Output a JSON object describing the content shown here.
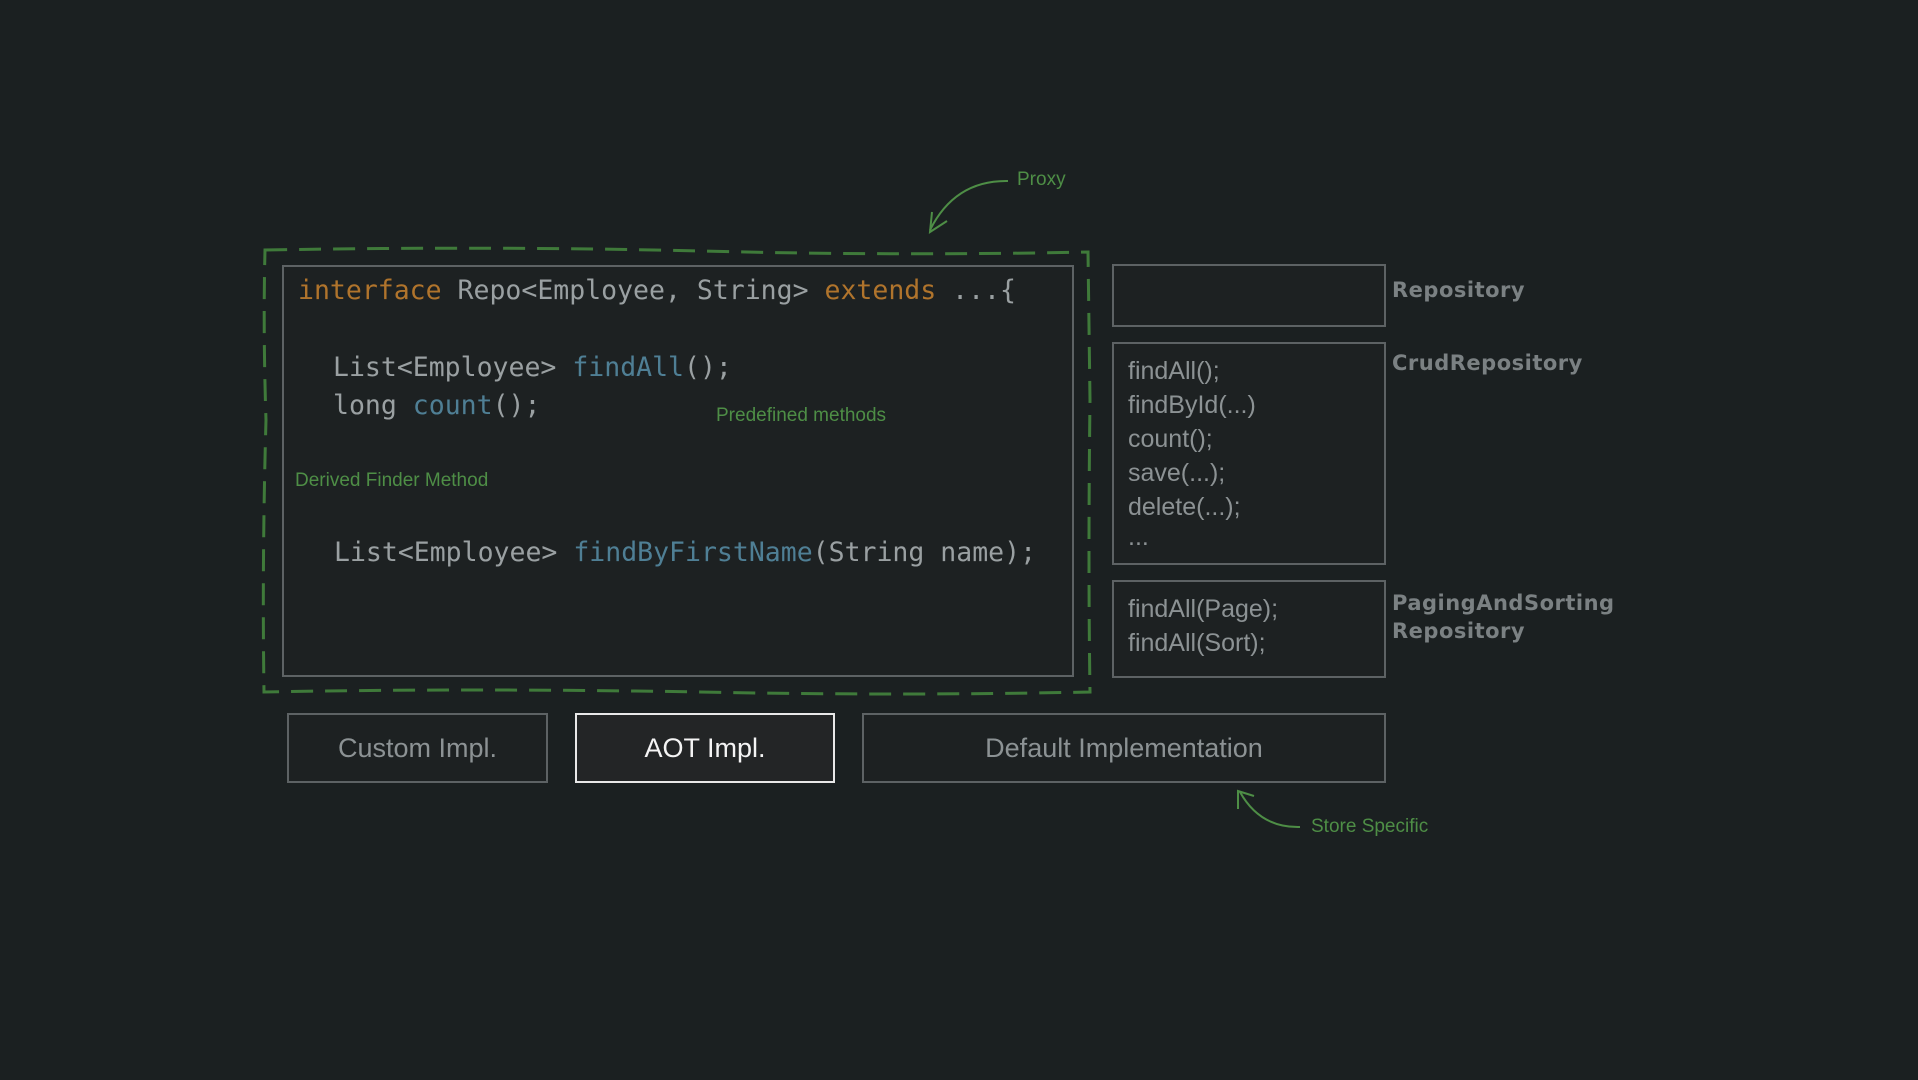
{
  "code": {
    "line1": {
      "kw1": "interface",
      "mid": " Repo<Employee, String> ",
      "kw2": "extends",
      "rest": " ...{"
    },
    "line2": {
      "pre": "List<Employee> ",
      "fn": "findAll",
      "post": "();"
    },
    "line3": {
      "pre": "long ",
      "fn": "count",
      "post": "();"
    },
    "line4": {
      "pre": "List<Employee> ",
      "fn": "findByFirstName",
      "post": "(String name);"
    }
  },
  "annotations": {
    "proxy": "Proxy",
    "predefined": "Predefined methods",
    "derived": "Derived Finder Method",
    "store": "Store Specific"
  },
  "side": {
    "repository_label": "Repository",
    "crud_label": "CrudRepository",
    "crud_items": [
      "findAll();",
      "findById(...)",
      "count();",
      "save(...);",
      "delete(...);",
      "..."
    ],
    "paging_label_line1": "PagingAndSorting",
    "paging_label_line2": "Repository",
    "paging_items": [
      "findAll(Page);",
      "findAll(Sort);"
    ]
  },
  "impl": {
    "custom": "Custom Impl.",
    "aot": "AOT Impl.",
    "default": "Default Implementation"
  },
  "colors": {
    "background": "#1b2021",
    "annotation_green": "#4e8e46",
    "keyword_orange": "#b0742c",
    "method_blue": "#4f7f95"
  }
}
